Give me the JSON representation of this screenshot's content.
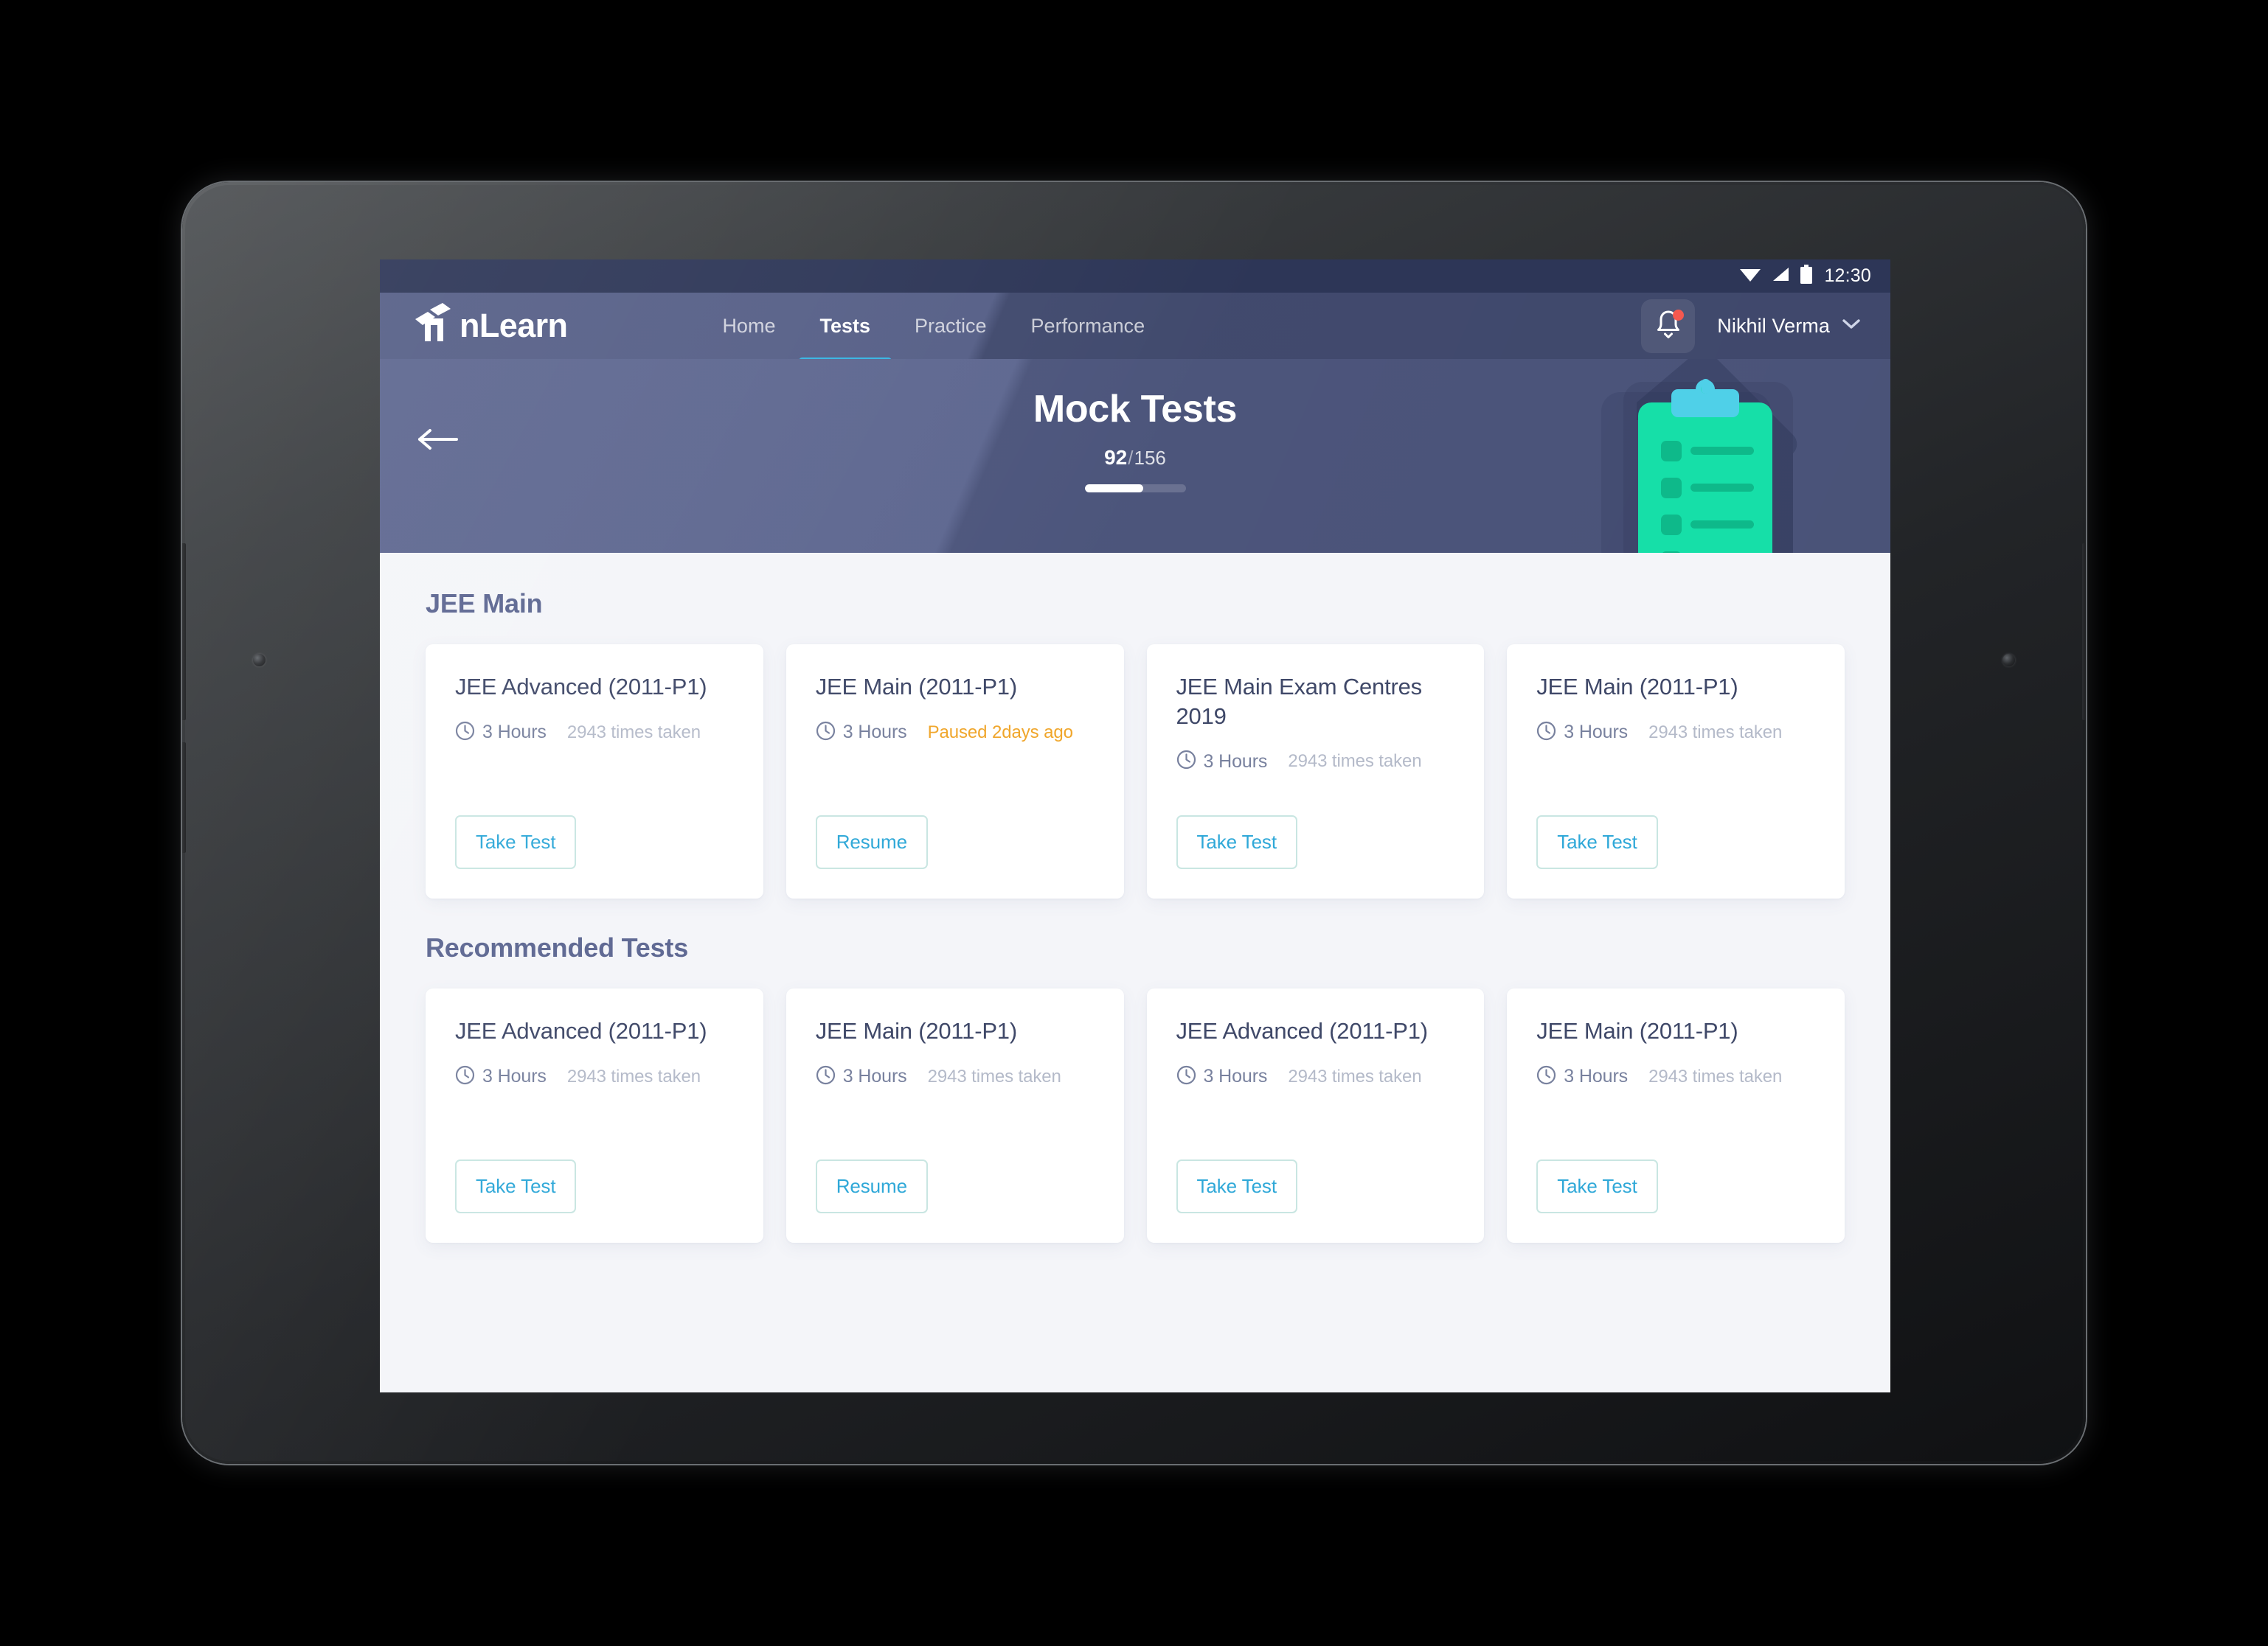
{
  "status_bar": {
    "time": "12:30",
    "icons": [
      "wifi-icon",
      "cellular-signal-icon",
      "battery-icon"
    ]
  },
  "top_nav": {
    "logo_text": "nLearn",
    "logo_icon": "book-logo-icon",
    "links": [
      {
        "label": "Home",
        "active": false
      },
      {
        "label": "Tests",
        "active": true
      },
      {
        "label": "Practice",
        "active": false
      },
      {
        "label": "Performance",
        "active": false
      }
    ],
    "notification_icon": "bell-icon",
    "notification_has_unread": true,
    "user_name": "Nikhil Verma",
    "user_chevron_icon": "chevron-down-icon"
  },
  "hero": {
    "back_icon": "arrow-left-icon",
    "title": "Mock Tests",
    "progress_current": "92",
    "progress_separator": "/",
    "progress_total": "156",
    "progress_percent": 58,
    "illustration": "clipboard-checklist-illustration"
  },
  "sections": [
    {
      "title": "JEE Main",
      "cards": [
        {
          "title": "JEE Advanced (2011-P1)",
          "clock_icon": "clock-icon",
          "duration": "3 Hours",
          "note": "2943 times taken",
          "note_state": "normal",
          "action": "Take Test"
        },
        {
          "title": "JEE Main (2011-P1)",
          "clock_icon": "clock-icon",
          "duration": "3 Hours",
          "note": "Paused 2days ago",
          "note_state": "paused",
          "action": "Resume"
        },
        {
          "title": "JEE Main Exam Centres 2019",
          "clock_icon": "clock-icon",
          "duration": "3 Hours",
          "note": "2943 times taken",
          "note_state": "normal",
          "action": "Take Test"
        },
        {
          "title": "JEE Main (2011-P1)",
          "clock_icon": "clock-icon",
          "duration": "3 Hours",
          "note": "2943 times taken",
          "note_state": "normal",
          "action": "Take Test"
        }
      ]
    },
    {
      "title": "Recommended Tests",
      "cards": [
        {
          "title": "JEE Advanced (2011-P1)",
          "clock_icon": "clock-icon",
          "duration": "3 Hours",
          "note": "2943 times taken",
          "note_state": "normal",
          "action": "Take Test"
        },
        {
          "title": "JEE Main (2011-P1)",
          "clock_icon": "clock-icon",
          "duration": "3 Hours",
          "note": "2943 times taken",
          "note_state": "normal",
          "action": "Resume"
        },
        {
          "title": "JEE Advanced (2011-P1)",
          "clock_icon": "clock-icon",
          "duration": "3 Hours",
          "note": "2943 times taken",
          "note_state": "normal",
          "action": "Take Test"
        },
        {
          "title": "JEE Main (2011-P1)",
          "clock_icon": "clock-icon",
          "duration": "3 Hours",
          "note": "2943 times taken",
          "note_state": "normal",
          "action": "Take Test"
        }
      ]
    }
  ],
  "colors": {
    "status_bar_bg": "#2d3657",
    "nav_bg": "#4c5680",
    "hero_bg": "#555f8a",
    "content_bg": "#f4f5f9",
    "accent_underline": "#3db7e4",
    "action_text": "#2fa8d8",
    "action_border": "#c9e6e2",
    "paused_text": "#f0a62b",
    "section_title": "#5c6691",
    "card_title": "#3f4868",
    "clipboard_green": "#16dfa8",
    "clipboard_clip": "#4fd0e8",
    "notification_dot": "#f4584f"
  }
}
